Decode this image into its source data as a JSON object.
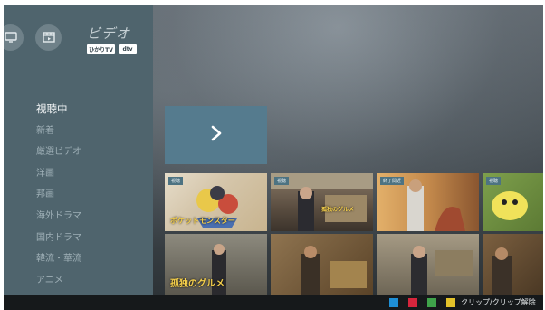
{
  "sidebar": {
    "title": "ビデオ",
    "services": [
      "ひかりTV",
      "dtv"
    ],
    "menu": [
      "視聴中",
      "新着",
      "厳選ビデオ",
      "洋画",
      "邦画",
      "海外ドラマ",
      "国内ドラマ",
      "韓流・華流",
      "アニメ"
    ],
    "active_index": 0
  },
  "featured": {
    "icon": "chevron-right-icon"
  },
  "rows": [
    [
      {
        "badge": "視聴",
        "caption": "ポケットモンスター",
        "color": "#d7c9b2"
      },
      {
        "badge": "視聴",
        "caption": "孤独のグルメ",
        "color": "#6a5a48"
      },
      {
        "badge": "終了間近",
        "caption": "",
        "color": "#c98a4e"
      },
      {
        "badge": "視聴",
        "caption": "",
        "color": "#6f8a3c"
      }
    ],
    [
      {
        "badge": "",
        "caption": "孤独のグルメ",
        "color": "#6c6a5c"
      },
      {
        "badge": "",
        "caption": "",
        "color": "#6b5436"
      },
      {
        "badge": "",
        "caption": "",
        "color": "#7b7462"
      },
      {
        "badge": "",
        "caption": "",
        "color": "#5e4a32"
      }
    ]
  ],
  "bottom_bar": {
    "keys": [
      "#1e8fd6",
      "#d6253c",
      "#3fa34a",
      "#e3c22a"
    ],
    "label": "クリップ/クリップ解除"
  }
}
